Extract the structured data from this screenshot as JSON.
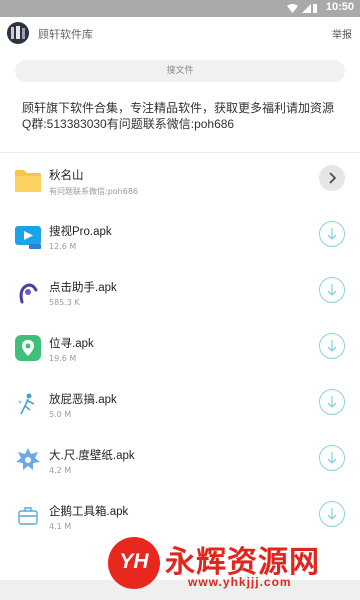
{
  "status_bar": {
    "time": "10:50"
  },
  "header": {
    "title": "顾轩软件库",
    "report_label": "举报"
  },
  "search": {
    "placeholder": "搜文件"
  },
  "notice": "顾轩旗下软件合集，专注精品软件，获取更多福利请加资源\nQ群:513383030有问题联系微信:poh686",
  "folder": {
    "name": "秋名山",
    "subtitle": "有问题联系微信:poh686"
  },
  "files": [
    {
      "name": "搜视Pro.apk",
      "size": "12.6 M",
      "icon": "tv-app-icon"
    },
    {
      "name": "点击助手.apk",
      "size": "585.3 K",
      "icon": "tap-app-icon"
    },
    {
      "name": "位寻.apk",
      "size": "19.6 M",
      "icon": "map-app-icon"
    },
    {
      "name": "放屁恶搞.apk",
      "size": "5.0 M",
      "icon": "prank-app-icon"
    },
    {
      "name": "大.尺.度壁纸.apk",
      "size": "4.2 M",
      "icon": "wallpaper-app-icon"
    },
    {
      "name": "企鹅工具箱.apk",
      "size": "4.1 M",
      "icon": "toolbox-app-icon"
    }
  ],
  "watermark": {
    "logo_text": "YH",
    "title": "永辉资源网",
    "url": "www.yhkjjj.com"
  },
  "colors": {
    "accent": "#8fd0e2",
    "folder": "#f8c549",
    "watermark": "#e0261d"
  }
}
